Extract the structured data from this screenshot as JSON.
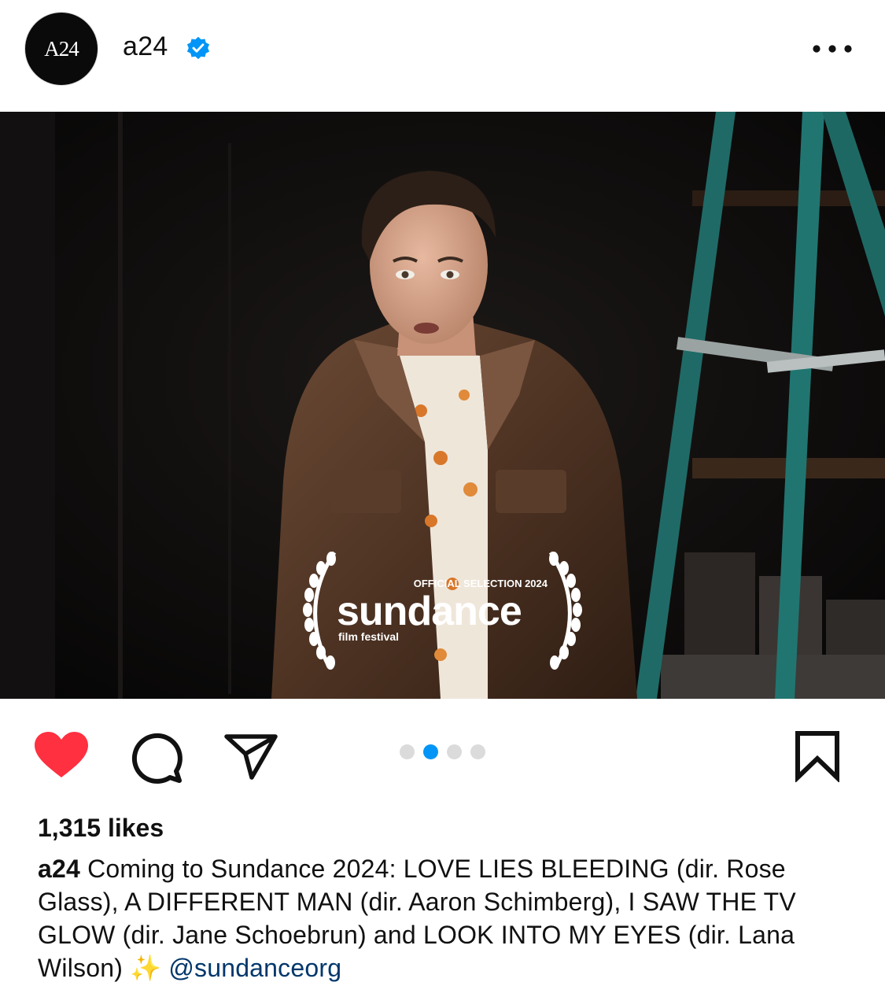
{
  "post": {
    "username": "a24",
    "avatar_text": "A24",
    "verified": true,
    "more_icon": "more-horizontal-icon",
    "image": {
      "laurel_top": "OFFICIAL SELECTION 2024",
      "laurel_main": "sundance",
      "laurel_sub": "film festival"
    },
    "carousel": {
      "count": 4,
      "active_index": 1
    },
    "liked": true,
    "likes_text": "1,315 likes",
    "caption": {
      "user": "a24",
      "text": "Coming to Sundance 2024: LOVE LIES BLEEDING (dir. Rose Glass), A DIFFERENT MAN (dir. Aaron Schimberg), I SAW THE TV GLOW (dir. Jane Schoebrun) and LOOK INTO MY EYES (dir. Lana Wilson) ✨",
      "mention": "@sundanceorg"
    }
  },
  "colors": {
    "like_red": "#ff3040",
    "verified_blue": "#0095f6",
    "mention_blue": "#00376b",
    "dot_inactive": "#dbdbdb"
  }
}
